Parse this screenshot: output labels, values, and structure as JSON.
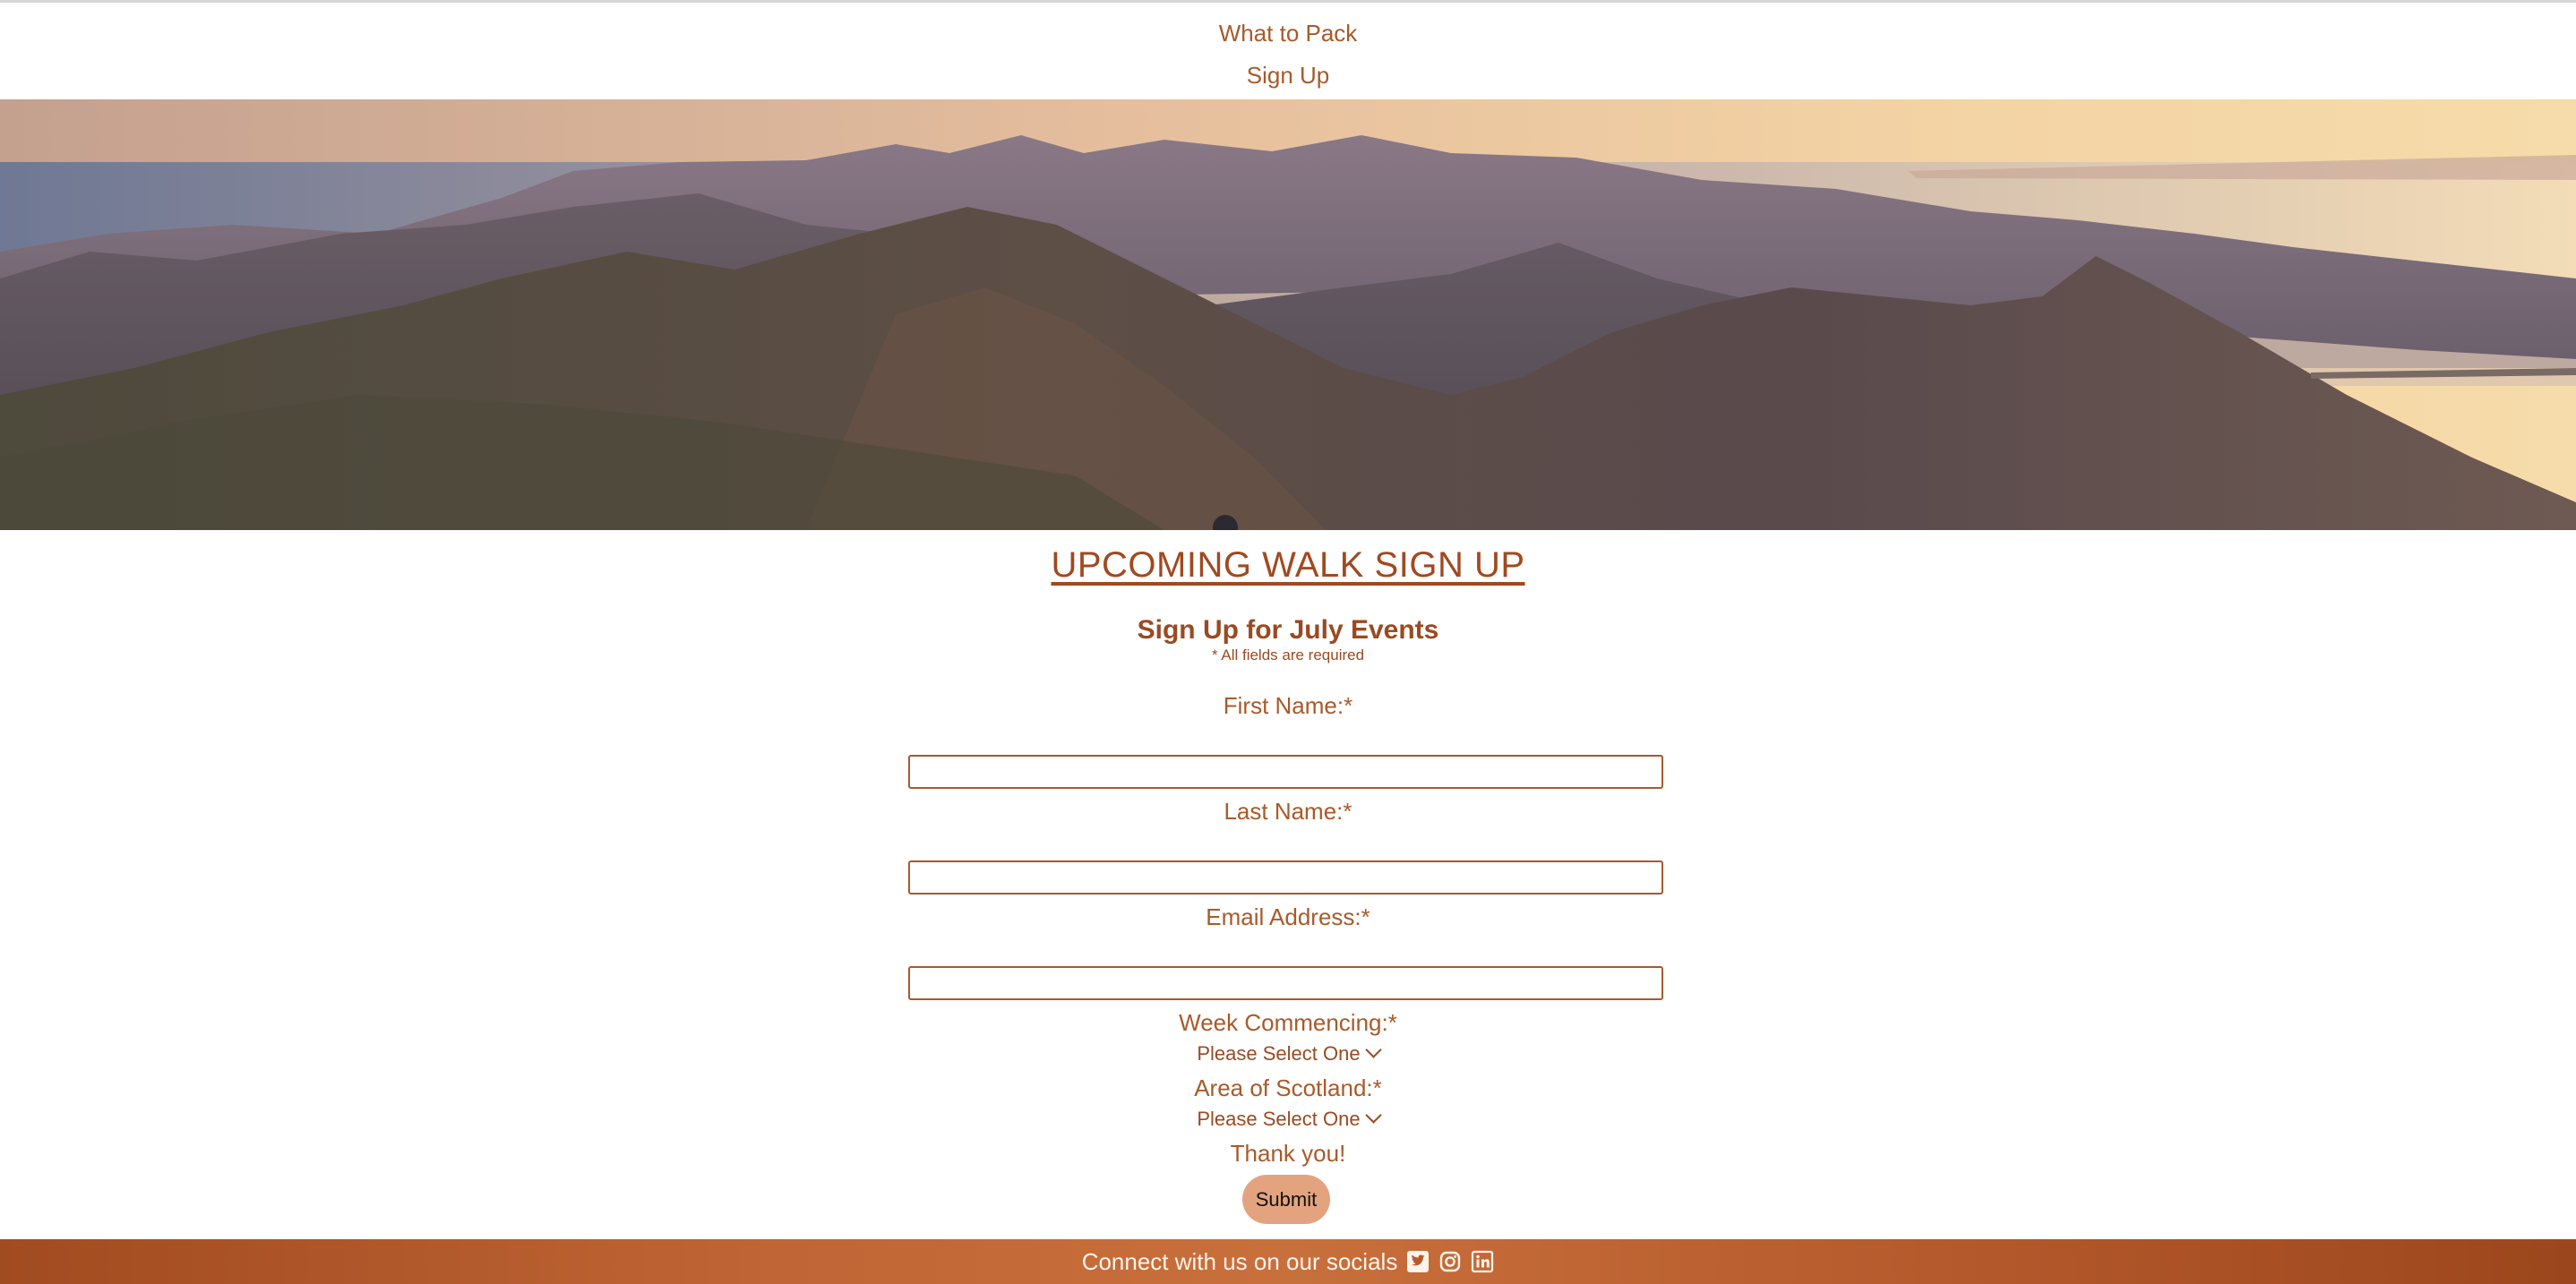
{
  "nav": {
    "items": [
      {
        "label": "What to Pack"
      },
      {
        "label": "Sign Up"
      }
    ]
  },
  "form": {
    "heading": "UPCOMING WALK SIGN UP",
    "subheading": "Sign Up for July Events",
    "required_note": "* All fields are required",
    "first_name_label": "First Name:*",
    "first_name_value": "",
    "last_name_label": "Last Name:*",
    "last_name_value": "",
    "email_label": "Email Address:*",
    "email_value": "",
    "week_label": "Week Commencing:*",
    "week_selected": "Please Select One",
    "area_label": "Area of Scotland:*",
    "area_selected": "Please Select One",
    "thanks": "Thank you!",
    "submit_label": "Submit"
  },
  "footer": {
    "text": "Connect with us on our socials",
    "icons": [
      "twitter-icon",
      "instagram-icon",
      "linkedin-icon"
    ]
  },
  "colors": {
    "text": "#9a4a22",
    "accent": "#a14920",
    "button": "#e4a37f",
    "footer": "#b55a2c"
  }
}
